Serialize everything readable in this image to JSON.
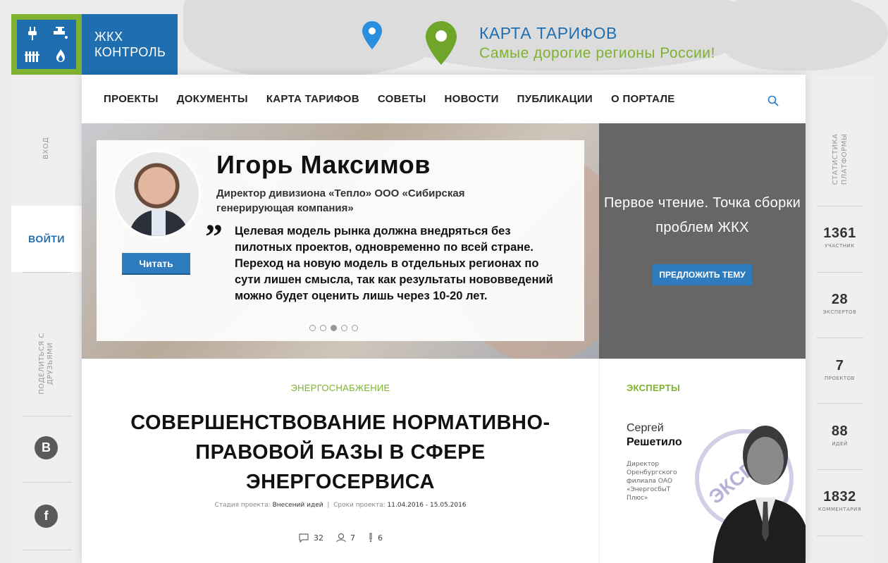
{
  "brand": {
    "line1": "ЖКХ",
    "line2": "КОНТРОЛЬ"
  },
  "logo_icons": [
    "plug-icon",
    "faucet-icon",
    "radiator-icon",
    "flame-icon"
  ],
  "tariff_banner": {
    "title": "КАРТА ТАРИФОВ",
    "subtitle": "Самые дорогие регионы России!"
  },
  "nav": {
    "items": [
      "ПРОЕКТЫ",
      "ДОКУМЕНТЫ",
      "КАРТА ТАРИФОВ",
      "СОВЕТЫ",
      "НОВОСТИ",
      "ПУБЛИКАЦИИ",
      "О ПОРТАЛЕ"
    ]
  },
  "left_sidebar": {
    "entry_label": "ВХОД",
    "login": "ВОЙТИ",
    "share_label": "ПОДЕЛИТЬСЯ С ДРУЗЬЯМИ",
    "vk": "B",
    "fb": "f"
  },
  "right_sidebar": {
    "label": "СТАТИСТИКА ПЛАТФОРМЫ",
    "stats": [
      {
        "value": "1361",
        "label": "УЧАСТНИК"
      },
      {
        "value": "28",
        "label": "ЭКСПЕРТОВ"
      },
      {
        "value": "7",
        "label": "ПРОЕКТОВ"
      },
      {
        "value": "88",
        "label": "ИДЕЙ"
      },
      {
        "value": "1832",
        "label": "КОММЕНТАРИЯ"
      }
    ]
  },
  "hero": {
    "name": "Игорь Максимов",
    "title": "Директор дивизиона «Тепло» ООО «Сибирская генерирующая компания»",
    "quote_mark": "”",
    "quote": "Целевая модель рынка должна внедряться без пилотных проектов, одновременно по всей стране. Переход на новую модель в отдельных регионах по сути лишен смысла, так как результаты нововведений можно будет оценить лишь через 10-20 лет.",
    "read_button": "Читать",
    "slides_total": 5,
    "slide_active": 3
  },
  "promo": {
    "text": "Первое чтение. Точка сборки проблем ЖКХ",
    "button": "ПРЕДЛОЖИТЬ ТЕМУ"
  },
  "article": {
    "category": "ЭНЕРГОСНАБЖЕНИЕ",
    "title": "СОВЕРШЕНСТВОВАНИЕ НОРМАТИВНО-ПРАВОВОЙ БАЗЫ В СФЕРЕ ЭНЕРГОСЕРВИСА",
    "stage_label": "Стадия проекта:",
    "stage_value": "Внесений идей",
    "dates_label": "Сроки проекта:",
    "dates_value": "11.04.2016 - 15.05.2016",
    "comments": "32",
    "users": "7",
    "ideas": "6"
  },
  "experts": {
    "title": "ЭКСПЕРТЫ",
    "first_name": "Сергей",
    "last_name": "Решетило",
    "position": "Директор Оренбургского филиала ОАО «ЭнергосбыТ Плюс»",
    "stamp": "ЭКСП"
  },
  "colors": {
    "blue": "#1f6fb0",
    "green": "#7fb231",
    "button_blue": "#2e7bbd",
    "promo_gray": "#666666"
  }
}
